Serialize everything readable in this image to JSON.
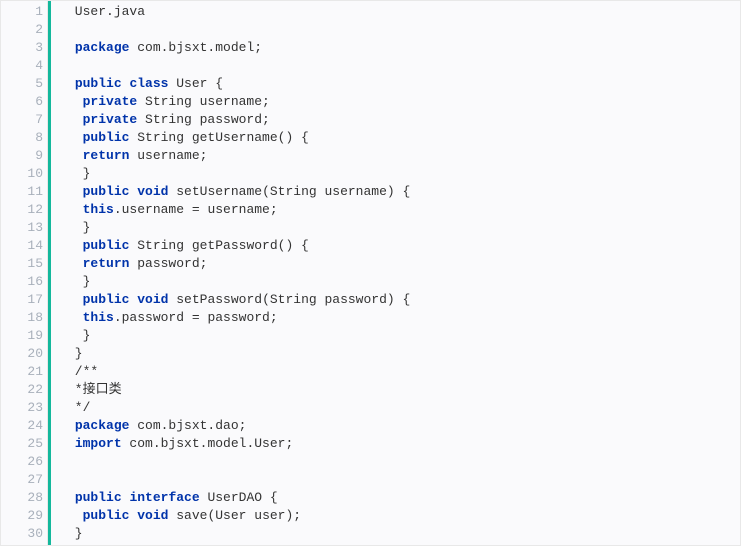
{
  "code": {
    "language": "java",
    "lines": [
      {
        "num": "1",
        "tokens": [
          {
            "t": "plain",
            "v": " User.java"
          }
        ]
      },
      {
        "num": "2",
        "tokens": []
      },
      {
        "num": "3",
        "tokens": [
          {
            "t": "plain",
            "v": " "
          },
          {
            "t": "kw",
            "v": "package"
          },
          {
            "t": "plain",
            "v": " com.bjsxt.model;"
          }
        ]
      },
      {
        "num": "4",
        "tokens": []
      },
      {
        "num": "5",
        "tokens": [
          {
            "t": "plain",
            "v": " "
          },
          {
            "t": "kw",
            "v": "public"
          },
          {
            "t": "plain",
            "v": " "
          },
          {
            "t": "kw",
            "v": "class"
          },
          {
            "t": "plain",
            "v": " User {"
          }
        ]
      },
      {
        "num": "6",
        "tokens": [
          {
            "t": "plain",
            "v": "  "
          },
          {
            "t": "kw",
            "v": "private"
          },
          {
            "t": "plain",
            "v": " String username;"
          }
        ]
      },
      {
        "num": "7",
        "tokens": [
          {
            "t": "plain",
            "v": "  "
          },
          {
            "t": "kw",
            "v": "private"
          },
          {
            "t": "plain",
            "v": " String password;"
          }
        ]
      },
      {
        "num": "8",
        "tokens": [
          {
            "t": "plain",
            "v": "  "
          },
          {
            "t": "kw",
            "v": "public"
          },
          {
            "t": "plain",
            "v": " String getUsername() {"
          }
        ]
      },
      {
        "num": "9",
        "tokens": [
          {
            "t": "plain",
            "v": "  "
          },
          {
            "t": "kw",
            "v": "return"
          },
          {
            "t": "plain",
            "v": " username;"
          }
        ]
      },
      {
        "num": "10",
        "tokens": [
          {
            "t": "plain",
            "v": "  }"
          }
        ]
      },
      {
        "num": "11",
        "tokens": [
          {
            "t": "plain",
            "v": "  "
          },
          {
            "t": "kw",
            "v": "public"
          },
          {
            "t": "plain",
            "v": " "
          },
          {
            "t": "kw",
            "v": "void"
          },
          {
            "t": "plain",
            "v": " setUsername(String username) {"
          }
        ]
      },
      {
        "num": "12",
        "tokens": [
          {
            "t": "plain",
            "v": "  "
          },
          {
            "t": "kw",
            "v": "this"
          },
          {
            "t": "plain",
            "v": ".username = username;"
          }
        ]
      },
      {
        "num": "13",
        "tokens": [
          {
            "t": "plain",
            "v": "  }"
          }
        ]
      },
      {
        "num": "14",
        "tokens": [
          {
            "t": "plain",
            "v": "  "
          },
          {
            "t": "kw",
            "v": "public"
          },
          {
            "t": "plain",
            "v": " String getPassword() {"
          }
        ]
      },
      {
        "num": "15",
        "tokens": [
          {
            "t": "plain",
            "v": "  "
          },
          {
            "t": "kw",
            "v": "return"
          },
          {
            "t": "plain",
            "v": " password;"
          }
        ]
      },
      {
        "num": "16",
        "tokens": [
          {
            "t": "plain",
            "v": "  }"
          }
        ]
      },
      {
        "num": "17",
        "tokens": [
          {
            "t": "plain",
            "v": "  "
          },
          {
            "t": "kw",
            "v": "public"
          },
          {
            "t": "plain",
            "v": " "
          },
          {
            "t": "kw",
            "v": "void"
          },
          {
            "t": "plain",
            "v": " setPassword(String password) {"
          }
        ]
      },
      {
        "num": "18",
        "tokens": [
          {
            "t": "plain",
            "v": "  "
          },
          {
            "t": "kw",
            "v": "this"
          },
          {
            "t": "plain",
            "v": ".password = password;"
          }
        ]
      },
      {
        "num": "19",
        "tokens": [
          {
            "t": "plain",
            "v": "  }"
          }
        ]
      },
      {
        "num": "20",
        "tokens": [
          {
            "t": "plain",
            "v": " }"
          }
        ]
      },
      {
        "num": "21",
        "tokens": [
          {
            "t": "plain",
            "v": " /**"
          }
        ]
      },
      {
        "num": "22",
        "tokens": [
          {
            "t": "plain",
            "v": " *接口类"
          }
        ]
      },
      {
        "num": "23",
        "tokens": [
          {
            "t": "plain",
            "v": " */"
          }
        ]
      },
      {
        "num": "24",
        "tokens": [
          {
            "t": "plain",
            "v": " "
          },
          {
            "t": "kw",
            "v": "package"
          },
          {
            "t": "plain",
            "v": " com.bjsxt.dao;"
          }
        ]
      },
      {
        "num": "25",
        "tokens": [
          {
            "t": "plain",
            "v": " "
          },
          {
            "t": "kw",
            "v": "import"
          },
          {
            "t": "plain",
            "v": " com.bjsxt.model.User;"
          }
        ]
      },
      {
        "num": "26",
        "tokens": []
      },
      {
        "num": "27",
        "tokens": []
      },
      {
        "num": "28",
        "tokens": [
          {
            "t": "plain",
            "v": " "
          },
          {
            "t": "kw",
            "v": "public"
          },
          {
            "t": "plain",
            "v": " "
          },
          {
            "t": "kw",
            "v": "interface"
          },
          {
            "t": "plain",
            "v": " UserDAO {"
          }
        ]
      },
      {
        "num": "29",
        "tokens": [
          {
            "t": "plain",
            "v": "  "
          },
          {
            "t": "kw",
            "v": "public"
          },
          {
            "t": "plain",
            "v": " "
          },
          {
            "t": "kw",
            "v": "void"
          },
          {
            "t": "plain",
            "v": " save(User user);"
          }
        ]
      },
      {
        "num": "30",
        "tokens": [
          {
            "t": "plain",
            "v": " }"
          }
        ]
      }
    ]
  }
}
